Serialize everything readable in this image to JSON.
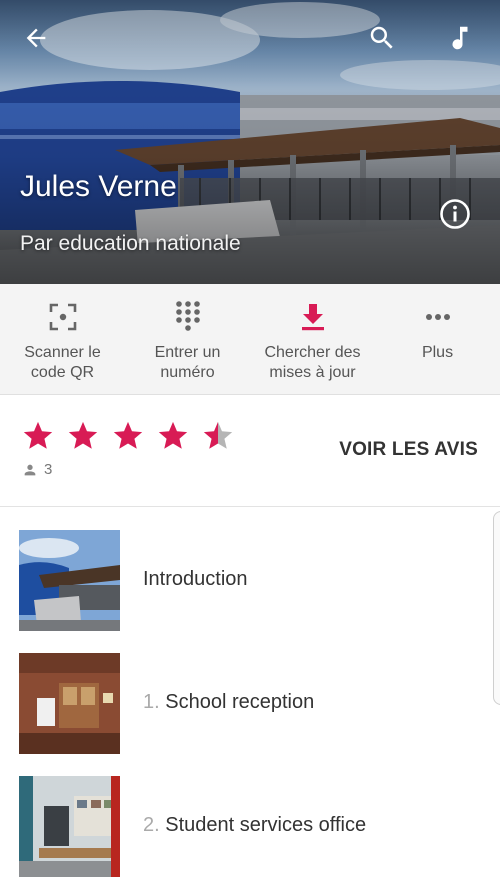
{
  "header": {
    "title": "Jules Verne",
    "subtitle": "Par education nationale",
    "icons": {
      "back": "arrow-left",
      "search": "magnifier",
      "music": "music-note",
      "info": "info-circle"
    }
  },
  "actions": [
    {
      "label": "Scanner le\ncode QR",
      "icon": "qr-scan"
    },
    {
      "label": "Entrer un\nnuméro",
      "icon": "dial-pad"
    },
    {
      "label": "Chercher des\nmises à jour",
      "icon": "download"
    },
    {
      "label": "Plus",
      "icon": "more-dots"
    }
  ],
  "rating": {
    "stars": 4.5,
    "max": 5,
    "reviewers": "3",
    "cta": "VOIR LES AVIS"
  },
  "list": [
    {
      "number": "",
      "title": "Introduction"
    },
    {
      "number": "1.",
      "title": "School reception"
    },
    {
      "number": "2.",
      "title": "Student services office"
    }
  ],
  "colors": {
    "accent": "#d81b55",
    "star_empty": "#b5b5b5",
    "action_bg": "#f4f4f4"
  }
}
